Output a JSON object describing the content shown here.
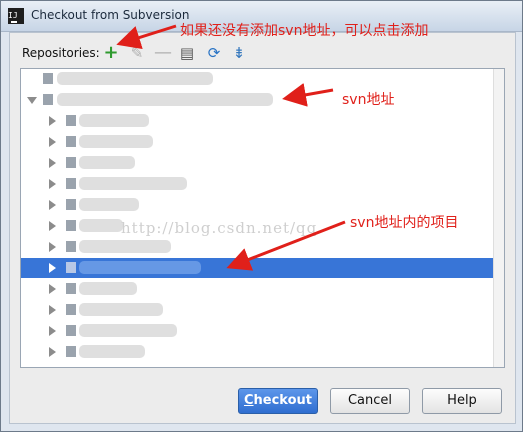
{
  "window": {
    "title": "Checkout from Subversion"
  },
  "toolbar": {
    "repositories_label": "Repositories:",
    "icons": [
      "add-icon",
      "edit-icon",
      "remove-icon",
      "browse-icon",
      "refresh-icon",
      "collapse-all-icon"
    ]
  },
  "watermark": "http://blog.csdn.net/qq",
  "buttons": {
    "checkout_accel": "C",
    "checkout_rest": "heckout",
    "cancel": "Cancel",
    "help": "Help"
  },
  "annotations": {
    "add_hint": "如果还没有添加svn地址，可以点击添加",
    "svn_address": "svn地址",
    "svn_items": "svn地址内的项目",
    "color": "#e0201a"
  },
  "colors": {
    "selection": "#3875d7",
    "primary_button": "#2f6ed0"
  }
}
